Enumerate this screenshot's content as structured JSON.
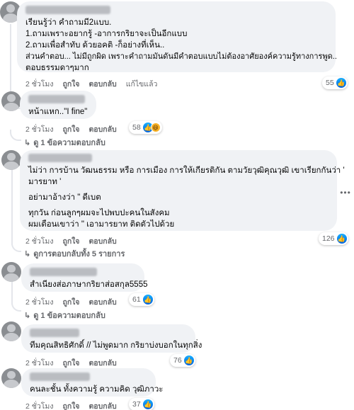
{
  "comments": [
    {
      "id": "c1",
      "lines": [
        "เรียนรู้ว่า คำถามมี2แบบ.",
        "1.ถามเพราะอยากรู้ -อาการกริยาจะเป็นอีกแบบ",
        "2.ถามเพื่อสำทับ ด้วยอคติ -ก็อย่างที่เห็น..",
        "ส่วนคำตอบ... ไม่มีถูกผิด เพราะคำถามมันดันมีคำตอบแบบไม่ต้องอาศัยองค์ความรู้ทางการพูด..",
        "ตอบธรรมดาๆมาก"
      ],
      "time": "2 ชั่วโมง",
      "like": "ถูกใจ",
      "reply": "ตอบกลับ",
      "edited": "แก้ไขแล้ว",
      "reaction_count": "55",
      "reactions": [
        "like"
      ]
    },
    {
      "id": "c2",
      "lines": [
        "หน้าแหก..\"I fine\""
      ],
      "time": "2 ชั่วโมง",
      "like": "ถูกใจ",
      "reply": "ตอบกลับ",
      "reaction_count": "58",
      "reactions": [
        "like",
        "haha"
      ],
      "replies_link": "ดู 1 ข้อความตอบกลับ"
    },
    {
      "id": "c3",
      "lines": [
        "ไม่ว่า การบ้าน วัฒนธรรม หรือ การเมือง การให้เกียรติกัน ตามวัยวุฒิคุณวุฒิ เขาเรียกกันว่า '",
        "มารยาท '",
        "อย่ามาอ้างว่า \" ดีเบต",
        "ทุกวัน ก่อนลูกๆผมจะไปพบปะคนในสังคม",
        "ผมเตือนเขาว่า \" เอามารยาท ติดตัวไปด้วย"
      ],
      "time": "2 ชั่วโมง",
      "like": "ถูกใจ",
      "reply": "ตอบกลับ",
      "reaction_count": "126",
      "reactions": [
        "like"
      ],
      "replies_link": "ดูการตอบกลับทั้ง 5 รายการ"
    },
    {
      "id": "c4",
      "lines": [
        "สำเนียงส่อภาษากริยาส่อสกุล5555"
      ],
      "time": "2 ชั่วโมง",
      "like": "ถูกใจ",
      "reply": "ตอบกลับ",
      "reaction_count": "61",
      "reactions": [
        "like"
      ],
      "replies_link": "ดู 1 ข้อความตอบกลับ"
    },
    {
      "id": "c5",
      "lines": [
        "ทีมคุณสิทธิศักดิ์ // ไม่พูดมาก กริยาบ่งบอกในทุกสิ่ง"
      ],
      "time": "2 ชั่วโมง",
      "like": "ถูกใจ",
      "reply": "ตอบกลับ",
      "reaction_count": "76",
      "reactions": [
        "like"
      ]
    },
    {
      "id": "c6",
      "lines": [
        "คนละชั้น ทั้งความรู้ ความคิด วุฒิภาวะ"
      ],
      "time": "2 ชั่วโมง",
      "like": "ถูกใจ",
      "reply": "ตอบกลับ",
      "reaction_count": "37",
      "reactions": [
        "like"
      ]
    }
  ],
  "icons": {
    "like": "thumbs-up-icon",
    "haha": "laughing-face-icon",
    "more": "more-options-icon",
    "reply_arrow": "reply-arrow-icon"
  },
  "colors": {
    "bubble": "#f0f2f5",
    "meta_text": "#65676b",
    "like_blue": "#0866ff",
    "haha_yellow": "#f7b125"
  }
}
